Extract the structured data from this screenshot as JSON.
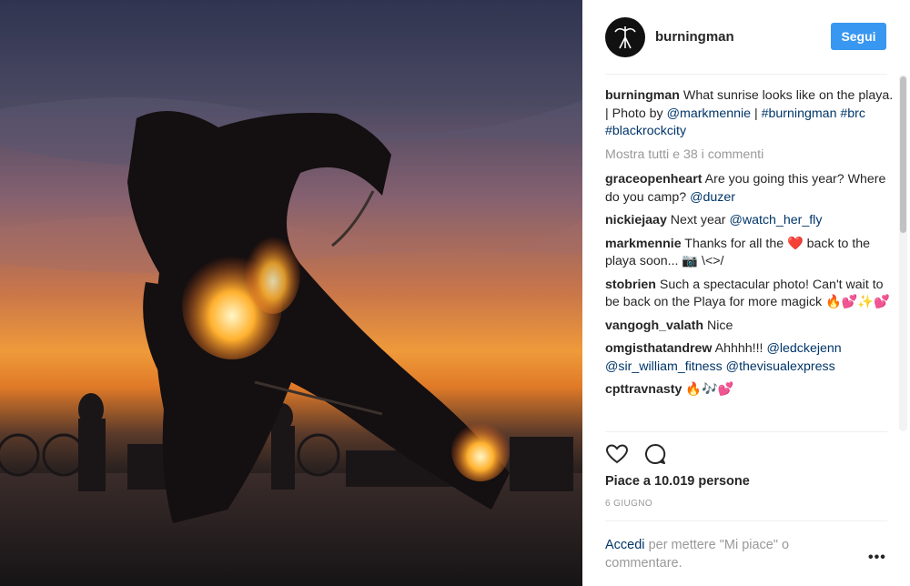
{
  "account": {
    "username": "burningman",
    "follow_label": "Segui"
  },
  "caption": {
    "username": "burningman",
    "text": "What sunrise looks like on the playa. | Photo by",
    "mention": "@markmennie",
    "sep": " | ",
    "tags": "#burningman #brc #blackrockcity"
  },
  "show_all_comments": "Mostra tutti e 38 i commenti",
  "comments": [
    {
      "user": "graceopenheart",
      "text": "Are you going this year? Where do you camp?",
      "link": "@duzer"
    },
    {
      "user": "nickiejaay",
      "text": "Next year",
      "link": "@watch_her_fly"
    },
    {
      "user": "markmennie",
      "text": "Thanks for all the ❤️ back to the playa soon... 📷 \\<>/",
      "link": ""
    },
    {
      "user": "stobrien",
      "text": "Such a spectacular photo! Can't wait to be back on the Playa for more magick 🔥💕✨💕",
      "link": ""
    },
    {
      "user": "vangogh_valath",
      "text": "Nice",
      "link": ""
    },
    {
      "user": "omgisthatandrew",
      "text": "Ahhhh!!!",
      "link": "@ledckejenn @sir_william_fitness @thevisualexpress"
    },
    {
      "user": "cpttravnasty",
      "text": "🔥🎶💕",
      "link": ""
    }
  ],
  "likes_text": "Piace a 10.019 persone",
  "date": "6 GIUGNO",
  "login": {
    "link": "Accedi",
    "text": "per mettere \"Mi piace\" o commentare."
  },
  "icons": {
    "like": "heart-icon",
    "comment": "comment-icon",
    "more": "more-options-icon"
  },
  "colors": {
    "accent": "#3897f0",
    "link": "#003569",
    "muted": "#999999"
  }
}
